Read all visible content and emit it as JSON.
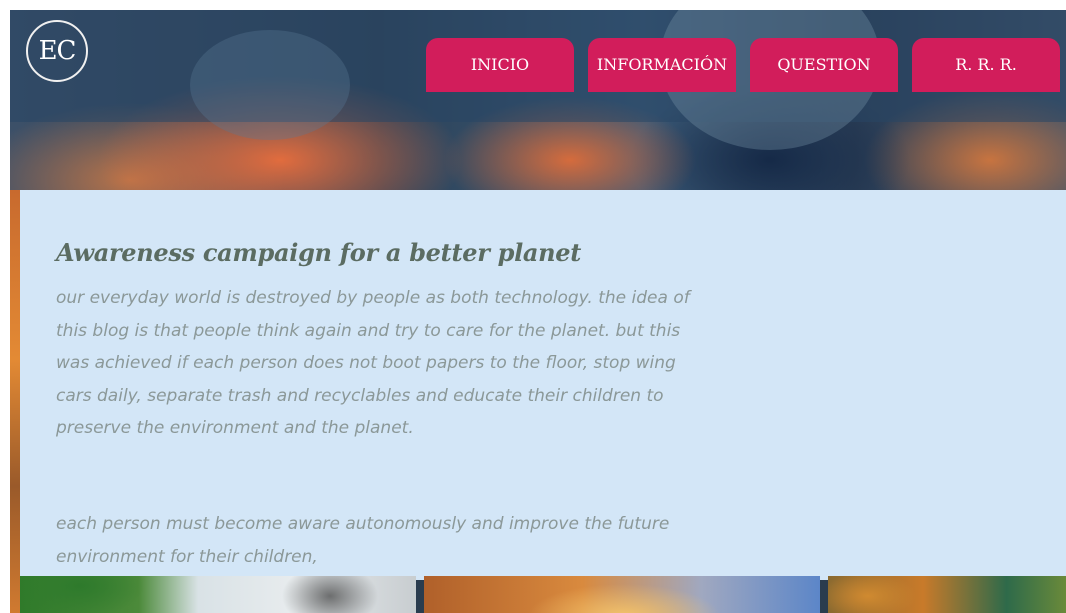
{
  "header": {
    "logo_text": "EC"
  },
  "nav": {
    "items": [
      {
        "label": "INICIO"
      },
      {
        "label": "INFORMACIÓN"
      },
      {
        "label": "QUESTION"
      },
      {
        "label": "R. R. R."
      }
    ],
    "accent_color": "#d21d5b"
  },
  "main": {
    "title": "Awareness campaign for a better planet",
    "paragraph1": "our everyday world is destroyed by people as both technology. the idea of this blog is that people think again  and try to care for the planet. but this was achieved if each person does not boot papers to the floor, stop wing cars daily, separate trash and recyclables and educate their children to preserve the environment and the planet.",
    "paragraph2": "each person must become aware autonomously and improve the future environment for their children,",
    "panel_color": "#d3e6f7",
    "title_color": "#5b6c62",
    "text_color": "#8b9898"
  }
}
